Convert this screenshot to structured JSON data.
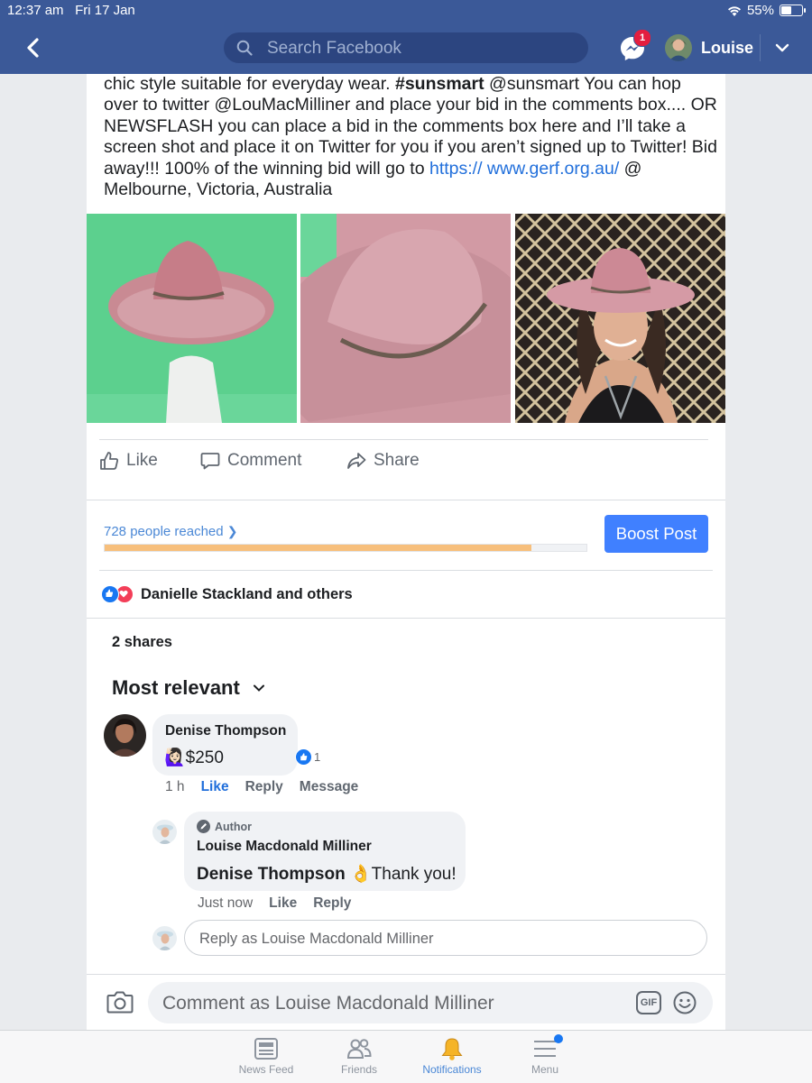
{
  "status_bar": {
    "time": "12:37 am",
    "date": "Fri 17 Jan",
    "battery": "55%",
    "battery_level": 0.55
  },
  "nav": {
    "search_placeholder": "Search Facebook",
    "messenger_badge": "1",
    "profile_name": "Louise"
  },
  "post": {
    "text_parts": {
      "p1": "chic style suitable for everyday wear. ",
      "hashtag": "#sunsmart",
      "p2": " @sunsmart You can hop over to twitter @LouMacMilliner and place your bid in the comments box.... OR NEWSFLASH you can place a bid in the comments box here and I’ll take a screen shot and place it on Twitter for you if you aren’t signed up to Twitter! Bid away!!! 100% of the winning bid will go to ",
      "link": "https:// www.gerf.org.au/",
      "p3": " @ Melbourne, Victoria, Australia"
    },
    "actions": {
      "like": "Like",
      "comment": "Comment",
      "share": "Share"
    },
    "reach_text": "728 people reached",
    "reach_fraction": 0.885,
    "boost_label": "Boost Post",
    "reactions_text": "Danielle Stackland and others",
    "shares_text": "2 shares",
    "sort_label": "Most relevant"
  },
  "comments": [
    {
      "name": "Denise Thompson",
      "emoji": "🙋🏻‍♀️",
      "text": "$250",
      "like_count": "1",
      "time": "1 h",
      "like": "Like",
      "reply": "Reply",
      "message": "Message"
    }
  ],
  "reply": {
    "author_badge": "Author",
    "name": "Louise Macdonald Milliner",
    "mention": "Denise Thompson",
    "emoji": "👌",
    "text": "Thank you!",
    "time": "Just now",
    "like": "Like",
    "reply": "Reply"
  },
  "reply_box_placeholder": "Reply as Louise Macdonald Milliner",
  "comment_placeholder": "Comment as Louise Macdonald Milliner",
  "gif_label": "GIF",
  "tabs": [
    {
      "label": "News Feed"
    },
    {
      "label": "Friends"
    },
    {
      "label": "Notifications"
    },
    {
      "label": "Menu"
    }
  ],
  "colors": {
    "nav_blue": "#3b5998",
    "accent": "#4080ff",
    "reach_bar": "#f7bf7c",
    "badge_red": "#e41e3f"
  }
}
